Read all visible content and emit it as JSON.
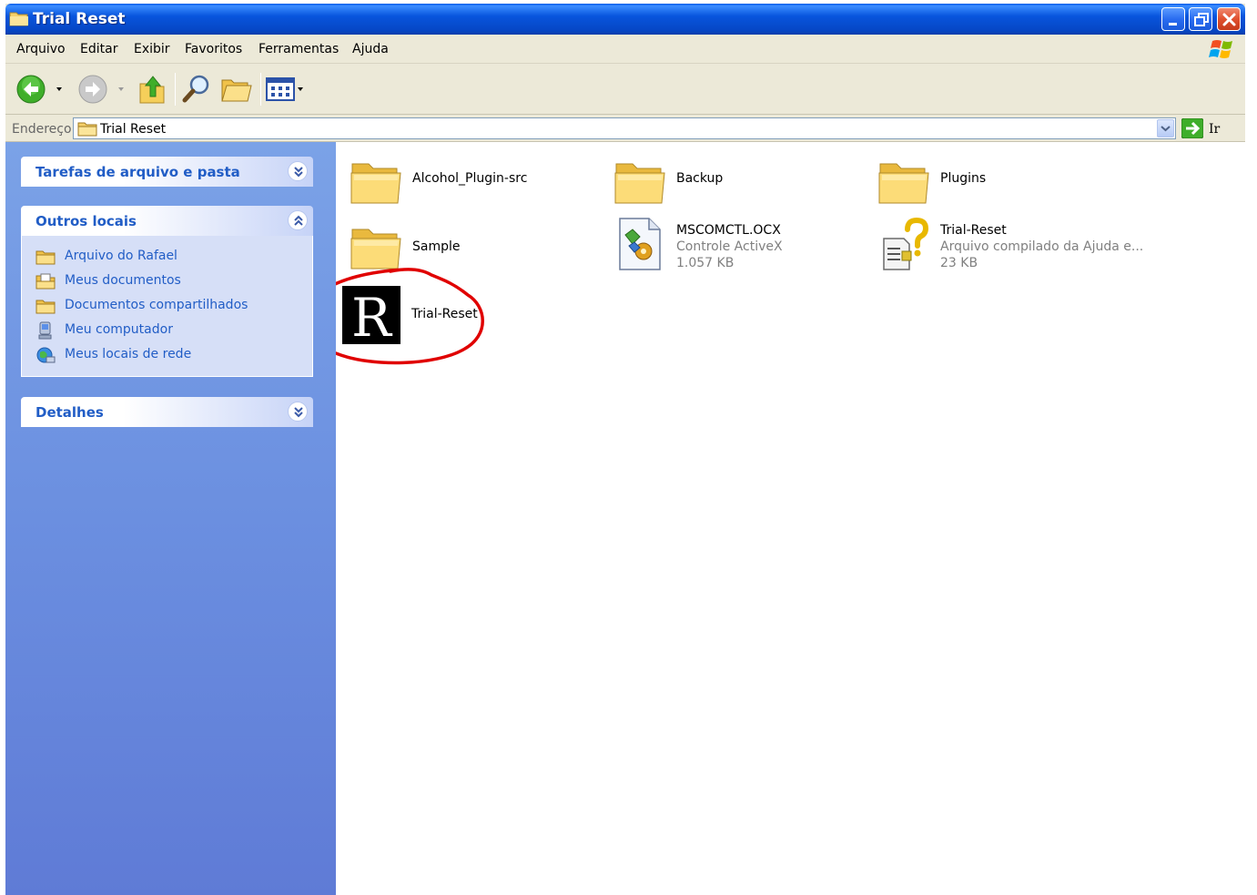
{
  "window": {
    "title": "Trial Reset"
  },
  "menu": [
    "Arquivo",
    "Editar",
    "Exibir",
    "Favoritos",
    "Ferramentas",
    "Ajuda"
  ],
  "address": {
    "label": "Endereço",
    "value": "Trial Reset",
    "go_label": "Ir"
  },
  "panels": {
    "tasks": {
      "title": "Tarefas de arquivo e pasta"
    },
    "places": {
      "title": "Outros locais",
      "links": [
        {
          "label": "Arquivo do Rafael",
          "icon": "folder-icon"
        },
        {
          "label": "Meus documentos",
          "icon": "documents-icon"
        },
        {
          "label": "Documentos compartilhados",
          "icon": "folder-icon"
        },
        {
          "label": "Meu computador",
          "icon": "computer-icon"
        },
        {
          "label": "Meus locais de rede",
          "icon": "network-icon"
        }
      ]
    },
    "details": {
      "title": "Detalhes"
    }
  },
  "files": [
    {
      "name": "Alcohol_Plugin-src",
      "type": "folder"
    },
    {
      "name": "Backup",
      "type": "folder"
    },
    {
      "name": "Plugins",
      "type": "folder"
    },
    {
      "name": "Sample",
      "type": "folder"
    },
    {
      "name": "MSCOMCTL.OCX",
      "desc": "Controle ActiveX",
      "size": "1.057 KB",
      "type": "activex"
    },
    {
      "name": "Trial-Reset",
      "desc": "Arquivo compilado da Ajuda e...",
      "size": "23 KB",
      "type": "help"
    },
    {
      "name": "Trial-Reset",
      "type": "exe",
      "icon_letter": "R"
    }
  ],
  "colors": {
    "title_bar": "#0855dd",
    "task_pane": "#6b8fe0",
    "link": "#215dc6",
    "annotation": "#e00000"
  }
}
